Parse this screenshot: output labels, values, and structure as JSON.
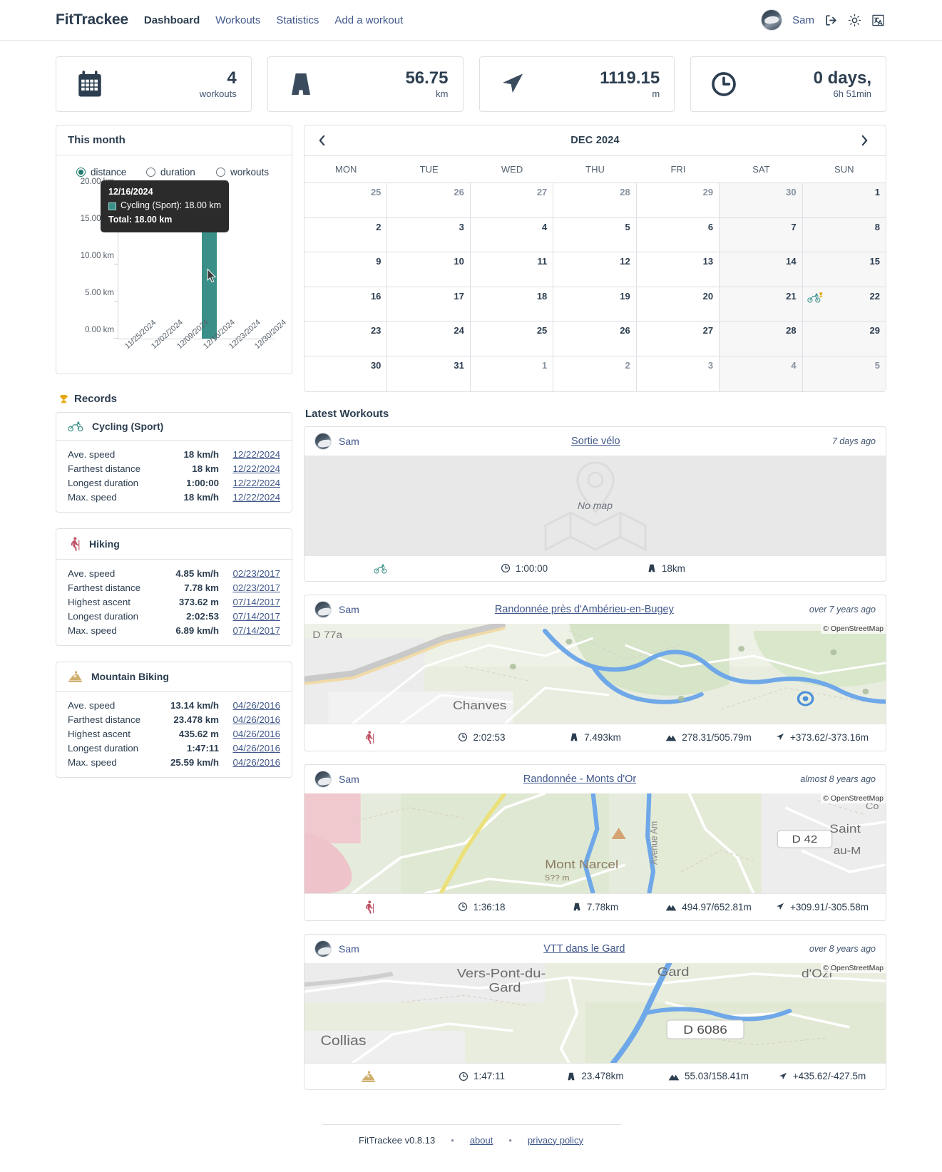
{
  "header": {
    "brand": "FitTrackee",
    "nav": [
      {
        "label": "Dashboard",
        "active": true
      },
      {
        "label": "Workouts",
        "active": false
      },
      {
        "label": "Statistics",
        "active": false
      },
      {
        "label": "Add a workout",
        "active": false
      }
    ],
    "user_name": "Sam",
    "icons": [
      "logout-icon",
      "theme-sun-icon",
      "language-icon"
    ]
  },
  "stats": [
    {
      "icon": "calendar-icon",
      "value": "4",
      "unit": "workouts"
    },
    {
      "icon": "road-icon",
      "value": "56.75",
      "unit": "km"
    },
    {
      "icon": "navigation-arrow-icon",
      "value": "1119.15",
      "unit": "m"
    },
    {
      "icon": "clock-icon",
      "value": "0 days,",
      "unit": "6h 51min"
    }
  ],
  "this_month": {
    "title": "This month",
    "options": [
      {
        "label": "distance",
        "selected": true
      },
      {
        "label": "duration",
        "selected": false
      },
      {
        "label": "workouts",
        "selected": false
      }
    ],
    "bar_label": "18.00 km",
    "tooltip": {
      "date": "12/16/2024",
      "series": "Cycling (Sport): 18.00 km",
      "total": "Total: 18.00 km",
      "swatch_color": "#3a9088"
    }
  },
  "chart_data": {
    "type": "bar",
    "title": "This month",
    "categories": [
      "11/25/2024",
      "12/02/2024",
      "12/09/2024",
      "12/16/2024",
      "12/23/2024",
      "12/30/2024"
    ],
    "values": [
      0,
      0,
      0,
      18.0,
      0,
      0
    ],
    "series": [
      {
        "name": "Cycling (Sport)",
        "values": [
          0,
          0,
          0,
          18.0,
          0,
          0
        ],
        "color": "#3a9088"
      }
    ],
    "ytick_labels": [
      "0.00 km",
      "5.00 km",
      "10.00 km",
      "15.00 km",
      "20.00 km"
    ],
    "ytick_values": [
      0,
      5,
      10,
      15,
      20
    ],
    "ylim": [
      0,
      20
    ],
    "xlabel": "",
    "ylabel": "",
    "unit": "km",
    "grid": false,
    "legend": false
  },
  "records": {
    "title": "Records",
    "groups": [
      {
        "sport": "Cycling (Sport)",
        "icon": "cycling-sport-icon",
        "color": "#3a9088",
        "rows": [
          {
            "name": "Ave. speed",
            "value": "18 km/h",
            "date": "12/22/2024"
          },
          {
            "name": "Farthest distance",
            "value": "18 km",
            "date": "12/22/2024"
          },
          {
            "name": "Longest duration",
            "value": "1:00:00",
            "date": "12/22/2024"
          },
          {
            "name": "Max. speed",
            "value": "18 km/h",
            "date": "12/22/2024"
          }
        ]
      },
      {
        "sport": "Hiking",
        "icon": "hiking-icon",
        "color": "#bf4f63",
        "rows": [
          {
            "name": "Ave. speed",
            "value": "4.85 km/h",
            "date": "02/23/2017"
          },
          {
            "name": "Farthest distance",
            "value": "7.78 km",
            "date": "02/23/2017"
          },
          {
            "name": "Highest ascent",
            "value": "373.62 m",
            "date": "07/14/2017"
          },
          {
            "name": "Longest duration",
            "value": "2:02:53",
            "date": "07/14/2017"
          },
          {
            "name": "Max. speed",
            "value": "6.89 km/h",
            "date": "07/14/2017"
          }
        ]
      },
      {
        "sport": "Mountain Biking",
        "icon": "mountain-biking-icon",
        "color": "#d0b070",
        "rows": [
          {
            "name": "Ave. speed",
            "value": "13.14 km/h",
            "date": "04/26/2016"
          },
          {
            "name": "Farthest distance",
            "value": "23.478 km",
            "date": "04/26/2016"
          },
          {
            "name": "Highest ascent",
            "value": "435.62 m",
            "date": "04/26/2016"
          },
          {
            "name": "Longest duration",
            "value": "1:47:11",
            "date": "04/26/2016"
          },
          {
            "name": "Max. speed",
            "value": "25.59 km/h",
            "date": "04/26/2016"
          }
        ]
      }
    ]
  },
  "calendar": {
    "title": "DEC 2024",
    "prev_label": "‹",
    "next_label": "›",
    "dow": [
      "MON",
      "TUE",
      "WED",
      "THU",
      "FRI",
      "SAT",
      "SUN"
    ],
    "weeks": [
      [
        {
          "d": "25",
          "other": true
        },
        {
          "d": "26",
          "other": true
        },
        {
          "d": "27",
          "other": true
        },
        {
          "d": "28",
          "other": true
        },
        {
          "d": "29",
          "other": true
        },
        {
          "d": "30",
          "other": true,
          "weekend": true
        },
        {
          "d": "1",
          "weekend": true
        }
      ],
      [
        {
          "d": "2"
        },
        {
          "d": "3"
        },
        {
          "d": "4"
        },
        {
          "d": "5"
        },
        {
          "d": "6"
        },
        {
          "d": "7",
          "weekend": true
        },
        {
          "d": "8",
          "weekend": true
        }
      ],
      [
        {
          "d": "9"
        },
        {
          "d": "10"
        },
        {
          "d": "11"
        },
        {
          "d": "12"
        },
        {
          "d": "13"
        },
        {
          "d": "14",
          "weekend": true
        },
        {
          "d": "15",
          "weekend": true
        }
      ],
      [
        {
          "d": "16"
        },
        {
          "d": "17"
        },
        {
          "d": "18"
        },
        {
          "d": "19"
        },
        {
          "d": "20"
        },
        {
          "d": "21",
          "weekend": true
        },
        {
          "d": "22",
          "weekend": true,
          "workout": "cycling-sport-icon",
          "record": true
        }
      ],
      [
        {
          "d": "23"
        },
        {
          "d": "24"
        },
        {
          "d": "25"
        },
        {
          "d": "26"
        },
        {
          "d": "27"
        },
        {
          "d": "28",
          "weekend": true
        },
        {
          "d": "29",
          "weekend": true
        }
      ],
      [
        {
          "d": "30"
        },
        {
          "d": "31"
        },
        {
          "d": "1",
          "other": true
        },
        {
          "d": "2",
          "other": true
        },
        {
          "d": "3",
          "other": true
        },
        {
          "d": "4",
          "other": true,
          "weekend": true
        },
        {
          "d": "5",
          "other": true,
          "weekend": true
        }
      ]
    ]
  },
  "latest_workouts": {
    "title": "Latest Workouts",
    "items": [
      {
        "user": "Sam",
        "name": "Sortie vélo",
        "ago": "7 days ago",
        "map": "none",
        "map_text": "No map",
        "sport_icon": "cycling-sport-icon",
        "sport_color": "#3a9088",
        "stats": [
          {
            "icon": "clock-icon",
            "value": "1:00:00"
          },
          {
            "icon": "road-icon",
            "value": "18km"
          }
        ]
      },
      {
        "user": "Sam",
        "name": "Randonnée près d'Ambérieu-en-Bugey",
        "ago": "over 7 years ago",
        "map": "osm",
        "map_credit": "© OpenStreetMap",
        "map_labels": [
          "D 77a",
          "Chanves"
        ],
        "sport_icon": "hiking-icon",
        "sport_color": "#bf4f63",
        "stats": [
          {
            "icon": "clock-icon",
            "value": "2:02:53"
          },
          {
            "icon": "road-icon",
            "value": "7.493km"
          },
          {
            "icon": "mountain-icon",
            "value": "278.31/505.79m"
          },
          {
            "icon": "navigation-arrow-icon",
            "value": "+373.62/-373.16m"
          }
        ]
      },
      {
        "user": "Sam",
        "name": "Randonnée - Monts d'Or",
        "ago": "almost 8 years ago",
        "map": "osm",
        "map_credit": "© OpenStreetMap",
        "map_labels": [
          "D 42",
          "Mont Narcel",
          "Avenue Am",
          "Saint",
          "au-M"
        ],
        "sport_icon": "hiking-icon",
        "sport_color": "#bf4f63",
        "stats": [
          {
            "icon": "clock-icon",
            "value": "1:36:18"
          },
          {
            "icon": "road-icon",
            "value": "7.78km"
          },
          {
            "icon": "mountain-icon",
            "value": "494.97/652.81m"
          },
          {
            "icon": "navigation-arrow-icon",
            "value": "+309.91/-305.58m"
          }
        ]
      },
      {
        "user": "Sam",
        "name": "VTT dans le Gard",
        "ago": "over 8 years ago",
        "map": "osm",
        "map_credit": "© OpenStreetMap",
        "map_labels": [
          "Vers-Pont-du-Gard",
          "Gard",
          "d'Ozi",
          "Collias",
          "D 6086"
        ],
        "sport_icon": "mountain-biking-icon",
        "sport_color": "#d0b070",
        "stats": [
          {
            "icon": "clock-icon",
            "value": "1:47:11"
          },
          {
            "icon": "road-icon",
            "value": "23.478km"
          },
          {
            "icon": "mountain-icon",
            "value": "55.03/158.41m"
          },
          {
            "icon": "navigation-arrow-icon",
            "value": "+435.62/-427.5m"
          }
        ]
      }
    ]
  },
  "footer": {
    "app": "FitTrackee",
    "version": "v0.8.13",
    "about": "about",
    "privacy": "privacy policy",
    "sep": "•"
  }
}
